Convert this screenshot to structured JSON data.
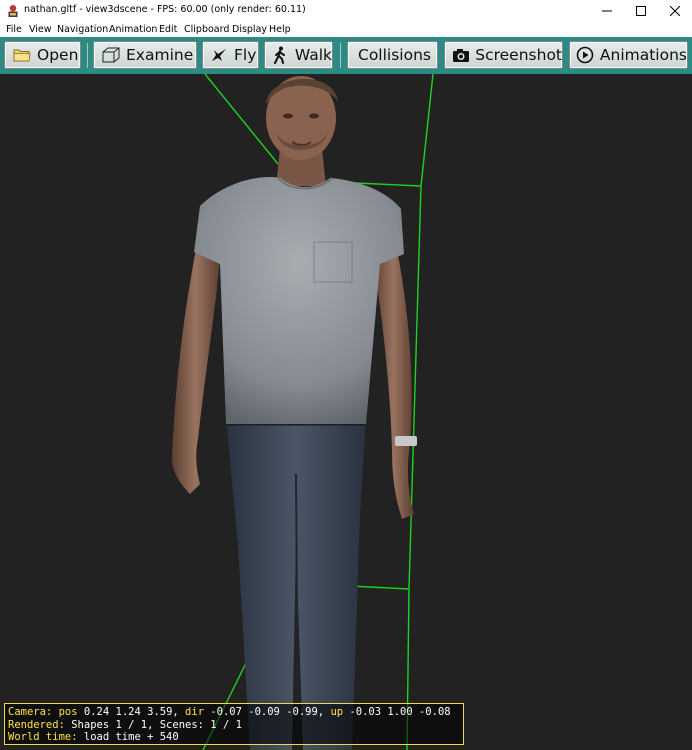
{
  "window": {
    "title": "nathan.gltf - view3dscene - FPS: 60.00 (only render: 60.11)",
    "app_icon": "view3dscene-app-icon",
    "controls": [
      "minimize-icon",
      "maximize-icon",
      "close-icon"
    ]
  },
  "menu": {
    "items": [
      "File",
      "View",
      "Navigation",
      "Animation",
      "Edit",
      "Clipboard",
      "Display",
      "Help"
    ]
  },
  "toolbar": {
    "open_label": "Open",
    "examine_label": "Examine",
    "fly_label": "Fly",
    "walk_label": "Walk",
    "collisions_label": "Collisions",
    "screenshot_label": "Screenshot",
    "animations_label": "Animations",
    "icons": {
      "open": "folder-icon",
      "examine": "cube-icon",
      "fly": "plane-icon",
      "walk": "walking-person-icon",
      "screenshot": "camera-icon",
      "animations": "play-circle-icon"
    }
  },
  "hud": {
    "camera_label": "Camera:",
    "pos_label": "pos",
    "pos_value": "0.24 1.24 3.59,",
    "dir_label": "dir",
    "dir_value": "-0.07 -0.09 -0.99,",
    "up_label": "up",
    "up_value": "-0.03 1.00 -0.08",
    "rendered_label": "Rendered:",
    "rendered_value": "Shapes 1 / 1, Scenes: 1 / 1",
    "world_label": "World time:",
    "world_value": "load time + 540"
  },
  "colors": {
    "toolbar_bg": "#2d8a84",
    "viewport_bg": "#222222",
    "bounding_box": "#1ed21e",
    "hud_key": "#ffe34a",
    "hud_border": "#f3d94a"
  }
}
